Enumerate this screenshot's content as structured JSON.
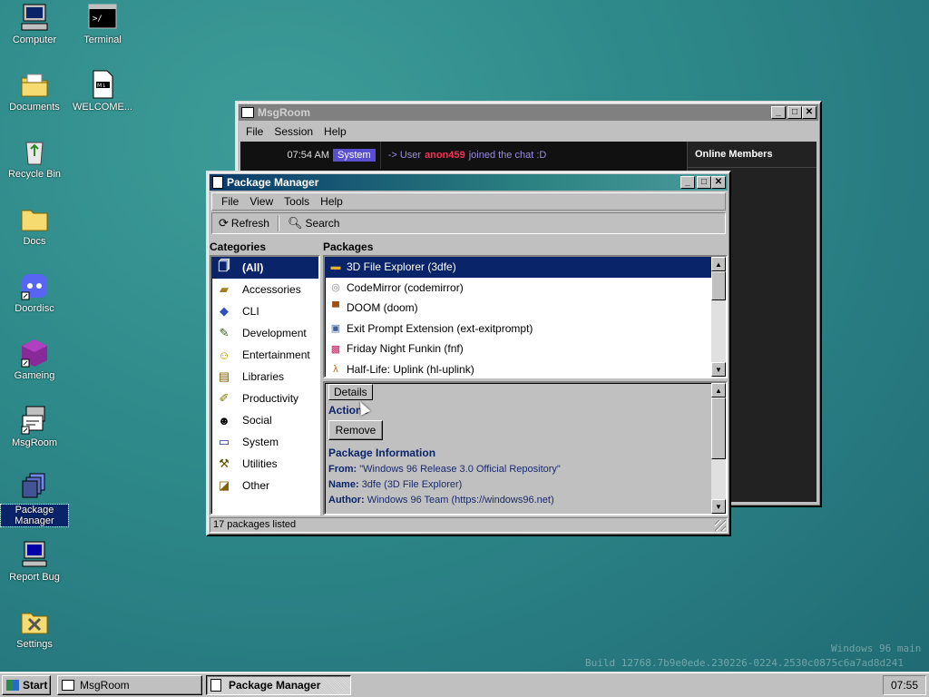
{
  "desktop": {
    "icons": [
      {
        "label": "Computer",
        "icon": "computer-icon"
      },
      {
        "label": "Terminal",
        "icon": "terminal-icon"
      },
      {
        "label": "Documents",
        "icon": "documents-folder-icon"
      },
      {
        "label": "WELCOME...",
        "icon": "markdown-file-icon"
      },
      {
        "label": "Recycle Bin",
        "icon": "recycle-bin-icon"
      },
      {
        "label": "Docs",
        "icon": "folder-icon"
      },
      {
        "label": "Doordisc",
        "icon": "discord-icon"
      },
      {
        "label": "Gameing",
        "icon": "cube-icon"
      },
      {
        "label": "MsgRoom",
        "icon": "msgroom-icon"
      },
      {
        "label": "Package Manager",
        "icon": "package-icon"
      },
      {
        "label": "Report Bug",
        "icon": "bug-report-icon"
      },
      {
        "label": "Settings",
        "icon": "settings-icon"
      }
    ],
    "watermark": {
      "line1": "Windows 96 main",
      "line2": "Build 12768.7b9e0ede.230226-0224.2530c0875c6a7ad8d241"
    }
  },
  "msgroom": {
    "title": "MsgRoom",
    "menu": [
      "File",
      "Session",
      "Help"
    ],
    "message": {
      "time": "07:54 AM",
      "sender": "System",
      "prefix": "-> User",
      "user": "anon459",
      "suffix": "joined the chat :D"
    },
    "online_header": "Online Members",
    "colors": {
      "username": "#ff2d55",
      "system_badge": "#5a4fcf"
    }
  },
  "pm": {
    "title": "Package Manager",
    "menu": [
      "File",
      "View",
      "Tools",
      "Help"
    ],
    "toolbar": {
      "refresh": "Refresh",
      "search": "Search"
    },
    "categories_label": "Categories",
    "packages_label": "Packages",
    "categories": [
      {
        "label": "(All)",
        "icon": "all-icon"
      },
      {
        "label": "Accessories",
        "icon": "accessories-icon"
      },
      {
        "label": "CLI",
        "icon": "cli-icon"
      },
      {
        "label": "Development",
        "icon": "development-icon"
      },
      {
        "label": "Entertainment",
        "icon": "entertainment-icon"
      },
      {
        "label": "Libraries",
        "icon": "libraries-icon"
      },
      {
        "label": "Productivity",
        "icon": "productivity-icon"
      },
      {
        "label": "Social",
        "icon": "social-icon"
      },
      {
        "label": "System",
        "icon": "system-icon"
      },
      {
        "label": "Utilities",
        "icon": "utilities-icon"
      },
      {
        "label": "Other",
        "icon": "other-icon"
      }
    ],
    "packages": [
      {
        "label": "3D File Explorer (3dfe)",
        "icon": "folder-icon"
      },
      {
        "label": "CodeMirror (codemirror)",
        "icon": "codemirror-icon"
      },
      {
        "label": "DOOM (doom)",
        "icon": "doom-icon"
      },
      {
        "label": "Exit Prompt Extension (ext-exitprompt)",
        "icon": "extension-icon"
      },
      {
        "label": "Friday Night Funkin (fnf)",
        "icon": "fnf-icon"
      },
      {
        "label": "Half-Life: Uplink (hl-uplink)",
        "icon": "half-life-icon"
      }
    ],
    "details": {
      "tab": "Details",
      "actions_label": "Actions",
      "remove_label": "Remove",
      "info_label": "Package Information",
      "from_label": "From:",
      "from_value": "\"Windows 96 Release 3.0 Official Repository\"",
      "name_label": "Name:",
      "name_value": "3dfe (3D File Explorer)",
      "author_label": "Author:",
      "author_value": "Windows 96 Team (https://windows96.net)"
    },
    "status": "17 packages listed"
  },
  "taskbar": {
    "start": "Start",
    "items": [
      {
        "label": "MsgRoom"
      },
      {
        "label": "Package Manager"
      }
    ],
    "clock": "07:55"
  }
}
